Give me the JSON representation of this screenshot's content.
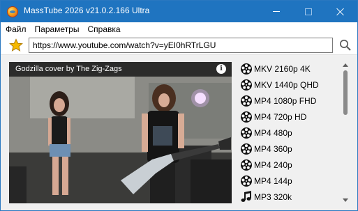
{
  "window": {
    "title": "MassTube 2026 v21.0.2.166 Ultra",
    "icon": "masstube-app-icon"
  },
  "menu": {
    "items": [
      "Файл",
      "Параметры",
      "Справка"
    ]
  },
  "toolbar": {
    "favorite_icon": "star-icon",
    "url_value": "https://www.youtube.com/watch?v=yEI0hRTrLGU",
    "search_icon": "search-icon"
  },
  "video": {
    "title": "Godzilla cover by The Zig-Zags",
    "info_icon": "info-icon",
    "info_glyph": "i"
  },
  "formats": {
    "items": [
      {
        "label": "MKV 2160p 4K",
        "icon": "film-reel-icon"
      },
      {
        "label": "MKV 1440p QHD",
        "icon": "film-reel-icon"
      },
      {
        "label": "MP4 1080p FHD",
        "icon": "film-reel-icon"
      },
      {
        "label": "MP4 720p HD",
        "icon": "film-reel-icon"
      },
      {
        "label": "MP4 480p",
        "icon": "film-reel-icon"
      },
      {
        "label": "MP4 360p",
        "icon": "film-reel-icon"
      },
      {
        "label": "MP4 240p",
        "icon": "film-reel-icon"
      },
      {
        "label": "MP4 144p",
        "icon": "film-reel-icon"
      },
      {
        "label": "MP3 320k",
        "icon": "music-note-icon"
      }
    ]
  },
  "colors": {
    "titlebar": "#1f74c0",
    "star": "#f5b800"
  }
}
